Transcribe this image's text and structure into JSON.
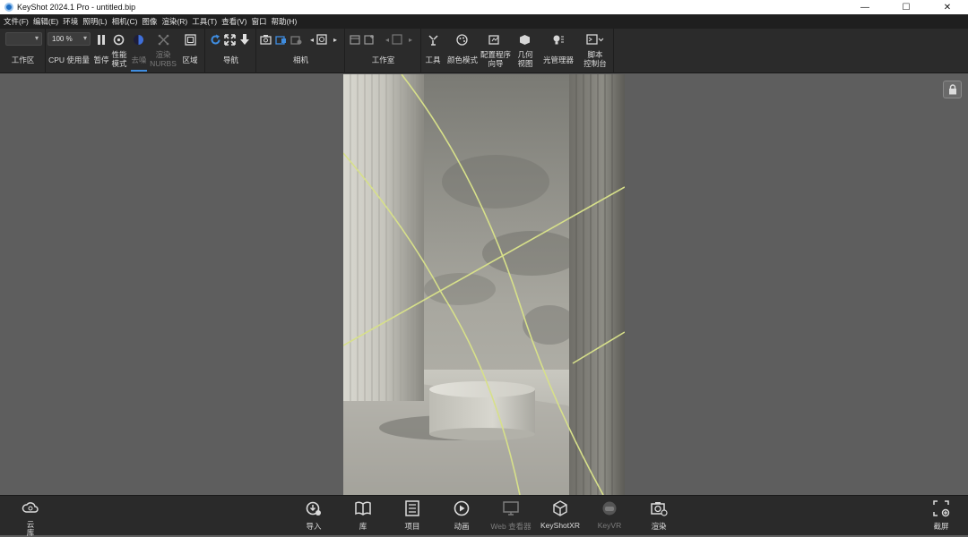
{
  "window": {
    "title": "KeyShot 2024.1 Pro  - untitled.bip",
    "minimize": "—",
    "maximize": "☐",
    "close": "✕"
  },
  "menu": [
    "文件(F)",
    "编辑(E)",
    "环境",
    "照明(L)",
    "相机(C)",
    "图像",
    "渲染(R)",
    "工具(T)",
    "查看(V)",
    "窗口",
    "帮助(H)"
  ],
  "toolbar": {
    "workspace_select": "",
    "workspace_label": "工作区",
    "cpu_value": "100 %",
    "cpu_label": "CPU 使用量",
    "pause_label": "暂停",
    "perf_label_1": "性能",
    "perf_label_2": "模式",
    "denoise_label": "去噪",
    "nurbs_label_1": "渲染",
    "nurbs_label_2": "NURBS",
    "region_label": "区域",
    "nav_label": "导航",
    "camera_label": "相机",
    "studio_label": "工作室",
    "tools_label": "工具",
    "color_mode_label": "颜色模式",
    "config_label_1": "配置程序",
    "config_label_2": "向导",
    "geo_label_1": "几何",
    "geo_label_2": "视图",
    "light_mgr_label": "光管理器",
    "script_label_1": "脚本",
    "script_label_2": "控制台"
  },
  "bottombar": {
    "cloud_1": "云",
    "cloud_2": "库",
    "import": "导入",
    "library": "库",
    "project": "项目",
    "animation": "动画",
    "web_viewer": "Web 查看器",
    "keyshotxr": "KeyShotXR",
    "keyvr": "KeyVR",
    "render": "渲染",
    "screenshot": "截屏"
  },
  "colors": {
    "accent": "#3f8de0",
    "guide_lines": "#d7e08a"
  }
}
